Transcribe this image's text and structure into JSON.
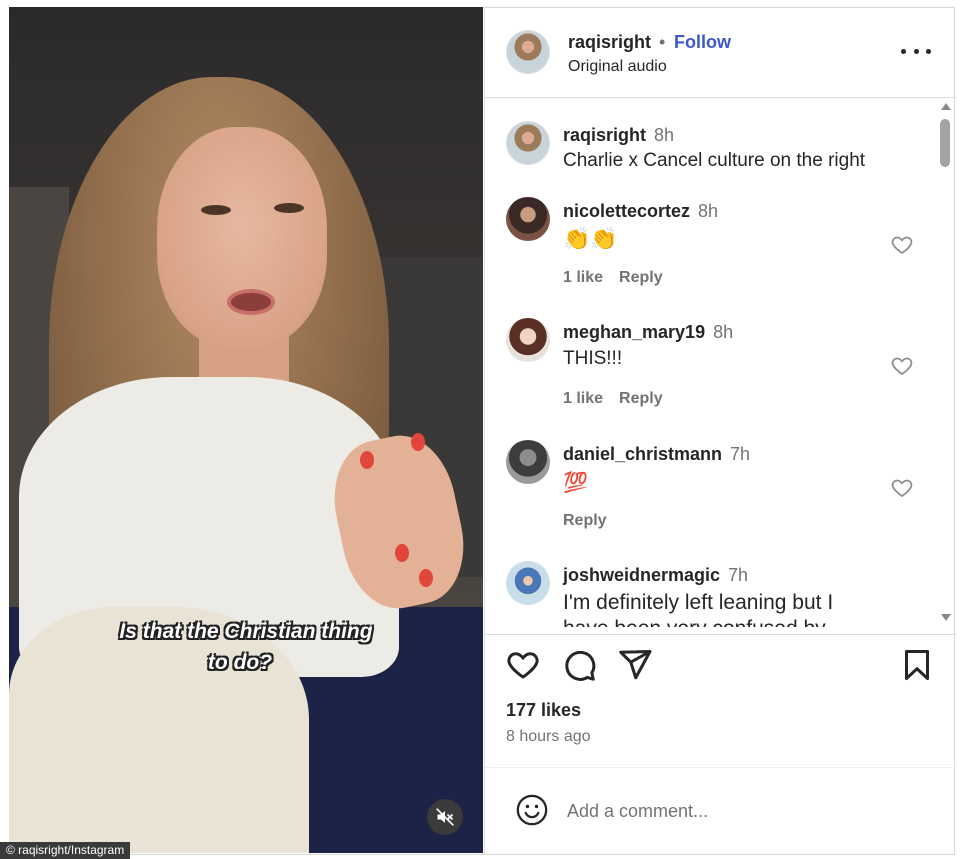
{
  "credit": "© raqisright/Instagram",
  "video": {
    "caption_line1": "Is that the Christian thing",
    "caption_line2": "to do?",
    "mute_icon": "speaker-muted-icon"
  },
  "header": {
    "username": "raqisright",
    "separator": "•",
    "follow_label": "Follow",
    "audio_label": "Original audio",
    "more_icon": "more-horizontal-icon"
  },
  "comments": [
    {
      "username": "raqisright",
      "time": "8h",
      "text": "Charlie x Cancel culture on the right"
    },
    {
      "username": "nicolettecortez",
      "time": "8h",
      "text": "👏👏",
      "likes": "1 like",
      "reply": "Reply"
    },
    {
      "username": "meghan_mary19",
      "time": "8h",
      "text": "THIS!!!",
      "likes": "1 like",
      "reply": "Reply"
    },
    {
      "username": "daniel_christmann",
      "time": "7h",
      "text": "💯",
      "reply": "Reply"
    },
    {
      "username": "joshweidnermagic",
      "time": "7h",
      "text": "I'm definitely left leaning but I",
      "text2": "have been very confused by"
    }
  ],
  "actions": {
    "like_icon": "heart-icon",
    "comment_icon": "comment-bubble-icon",
    "share_icon": "paper-plane-icon",
    "save_icon": "bookmark-icon"
  },
  "likes_count": "177 likes",
  "posted": "8 hours ago",
  "add_comment": {
    "placeholder": "Add a comment...",
    "emoji_icon": "smiley-icon"
  },
  "colors": {
    "follow_blue": "#3c58c9",
    "muted_text": "#737373",
    "text": "#262626"
  }
}
